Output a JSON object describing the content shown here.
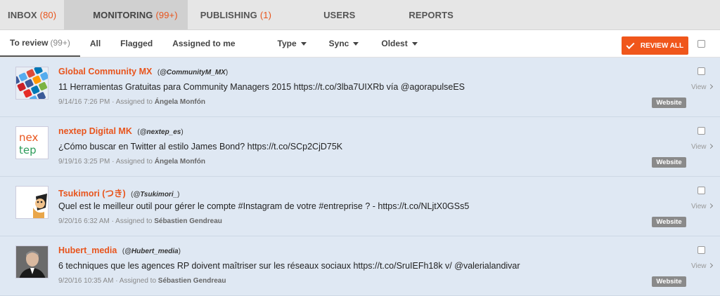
{
  "topnav": {
    "tabs": [
      {
        "label": "INBOX",
        "count": "(80)"
      },
      {
        "label": "MONITORING",
        "count": "(99+)"
      },
      {
        "label": "PUBLISHING",
        "count": "(1)"
      },
      {
        "label": "USERS",
        "count": ""
      },
      {
        "label": "REPORTS",
        "count": ""
      }
    ]
  },
  "subnav": {
    "tabs": [
      {
        "label": "To review",
        "count": "(99+)"
      },
      {
        "label": "All"
      },
      {
        "label": "Flagged"
      },
      {
        "label": "Assigned to me"
      }
    ],
    "filters": [
      "Type",
      "Sync",
      "Oldest"
    ],
    "review_all_label": "REVIEW ALL"
  },
  "colors": {
    "accent": "#f0561b",
    "name": "#e8541c",
    "badge": "#8a8a8a"
  },
  "items": [
    {
      "name": "Global Community MX",
      "handle": "@CommunityM_MX",
      "text": "11 Herramientas Gratuitas para Community Managers 2015 https://t.co/3lba7UIXRb vía @agorapulseES",
      "date": "9/14/16 7:26 PM",
      "assigned_prefix": "· Assigned to",
      "assignee": "Ángela Monfón",
      "view": "View",
      "badge": "Website",
      "avatar": "social-icons-avatar"
    },
    {
      "name": "nextep Digital MK",
      "handle": "@nextep_es",
      "text": "¿Cómo buscar en Twitter al estilo James Bond? https://t.co/SCp2CjD75K",
      "date": "9/19/16 3:25 PM",
      "assigned_prefix": "· Assigned to",
      "assignee": "Ángela Monfón",
      "view": "View",
      "badge": "Website",
      "avatar": "nextep-logo-avatar",
      "logo_top": "nex",
      "logo_bottom": "tep"
    },
    {
      "name": "Tsukimori (つき)",
      "handle": "@Tsukimori_",
      "text": "Quel est le meilleur outil pour gérer le compte #Instagram de votre #entreprise ? - https://t.co/NLjtX0GSs5",
      "date": "9/20/16 6:32 AM",
      "assigned_prefix": "· Assigned to",
      "assignee": "Sébastien Gendreau",
      "view": "View",
      "badge": "Website",
      "avatar": "cartoon-avatar"
    },
    {
      "name": "Hubert_media",
      "handle": "@Hubert_media",
      "text": "6 techniques que les agences RP doivent maîtriser sur les réseaux sociaux https://t.co/SruIEFh18k v/ @valerialandivar",
      "date": "9/20/16 10:35 AM",
      "assigned_prefix": "· Assigned to",
      "assignee": "Sébastien Gendreau",
      "view": "View",
      "badge": "Website",
      "avatar": "person-photo-avatar"
    }
  ]
}
